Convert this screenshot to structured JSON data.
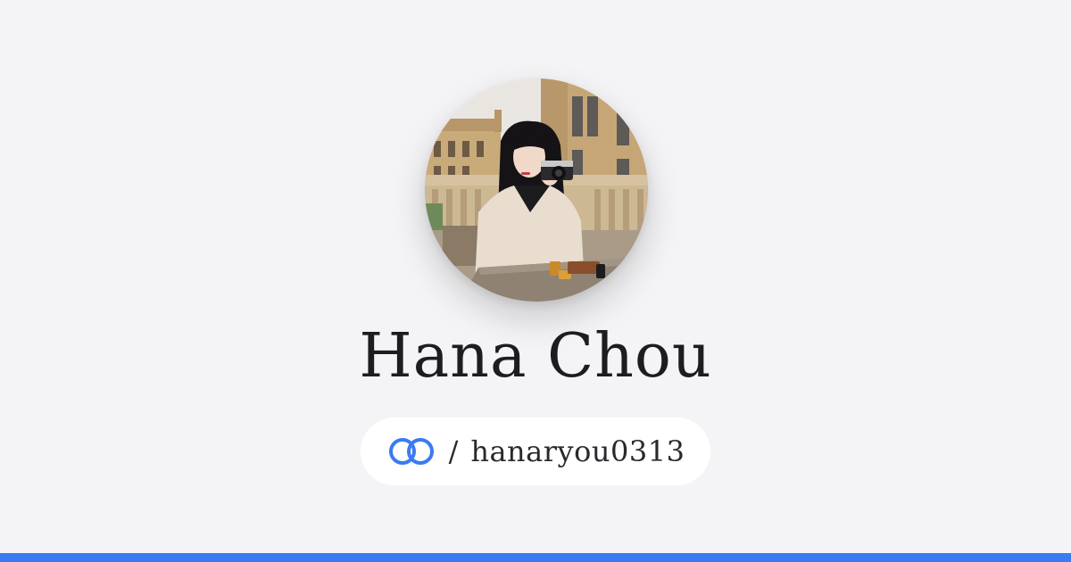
{
  "profile": {
    "name": "Hana Chou",
    "separator": "/",
    "handle": "hanaryou0313",
    "avatar_icon": "profile-photo",
    "link_icon": "linked-rings-icon"
  },
  "colors": {
    "background": "#f4f4f6",
    "accent": "#3a7bf2",
    "text": "#1d1d1f",
    "pill": "#ffffff"
  }
}
